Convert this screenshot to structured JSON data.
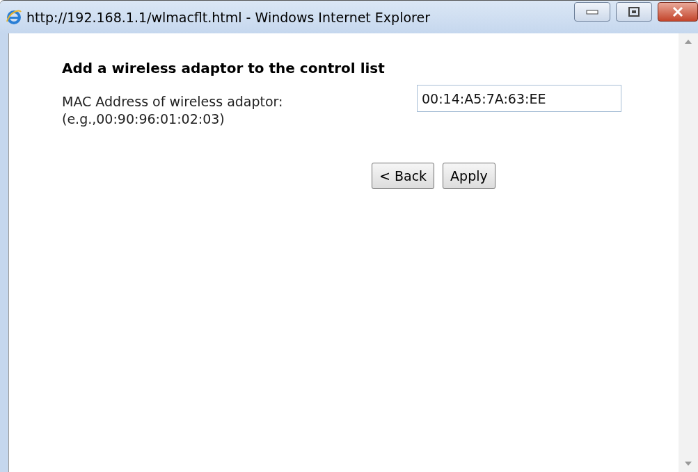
{
  "window": {
    "title": "http://192.168.1.1/wlmacflt.html - Windows Internet Explorer"
  },
  "heading": "Add a wireless adaptor to the control list",
  "mac_field": {
    "label": "MAC Address of wireless adaptor:",
    "hint": "(e.g.,00:90:96:01:02:03)",
    "value": "00:14:A5:7A:63:EE"
  },
  "buttons": [
    "< Back",
    "Apply"
  ]
}
